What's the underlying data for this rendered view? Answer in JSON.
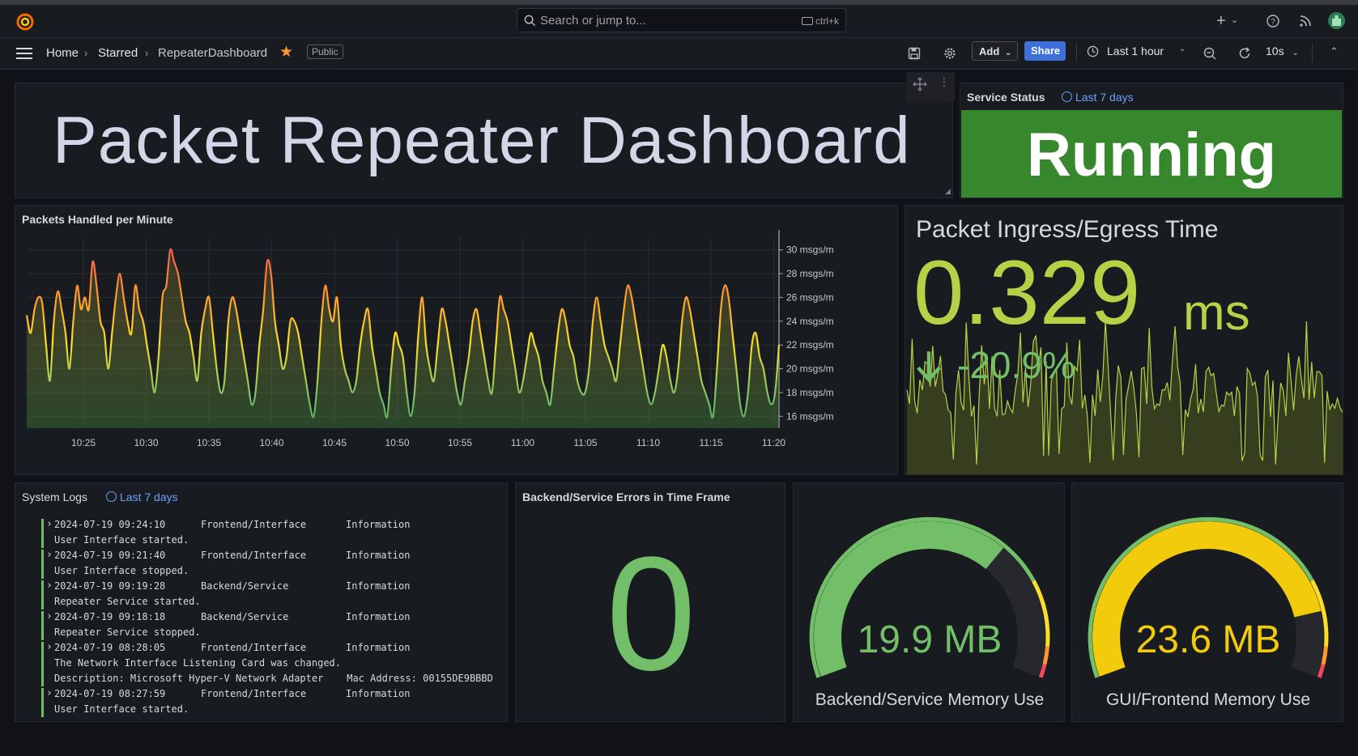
{
  "topbar": {
    "search_placeholder": "Search or jump to...",
    "search_shortcut": "ctrl+k"
  },
  "breadcrumb": {
    "home": "Home",
    "starred": "Starred",
    "dashboard": "RepeaterDashboard",
    "visibility": "Public"
  },
  "toolbar": {
    "add_label": "Add",
    "share_label": "Share",
    "time_range": "Last 1 hour",
    "refresh_interval": "10s"
  },
  "title_panel": {
    "text": "Packet Repeater Dashboard"
  },
  "service_status": {
    "title": "Service Status",
    "time_link": "Last 7 days",
    "value": "Running",
    "color": "#37872d"
  },
  "packets_chart": {
    "title": "Packets Handled per Minute"
  },
  "chart_data": {
    "type": "line",
    "x": [
      "10:25",
      "10:30",
      "10:35",
      "10:40",
      "10:45",
      "10:50",
      "10:55",
      "11:00",
      "11:05",
      "11:10",
      "11:15",
      "11:20"
    ],
    "ylim": [
      15,
      31
    ],
    "y_ticks": [
      "30 msgs/m",
      "28 msgs/m",
      "26 msgs/m",
      "24 msgs/m",
      "22 msgs/m",
      "20 msgs/m",
      "18 msgs/m",
      "16 msgs/m"
    ],
    "series": [
      {
        "values": [
          24.5,
          23,
          25,
          26,
          25.5,
          22,
          19,
          24,
          26.5,
          25,
          23,
          20,
          24,
          27,
          25,
          26,
          25,
          29,
          27,
          24,
          23,
          20,
          23,
          26,
          28,
          26,
          24,
          23,
          27,
          25,
          24,
          22,
          20,
          18,
          21,
          26,
          27,
          30,
          29,
          28,
          26,
          24,
          23,
          21,
          19,
          23,
          25,
          26,
          23,
          20,
          18,
          19,
          24,
          26,
          25,
          23,
          21,
          19,
          17,
          18,
          22,
          25,
          29,
          28,
          24,
          22,
          20,
          21,
          24,
          24,
          23,
          21,
          19,
          17,
          16,
          19,
          24,
          27,
          25,
          24,
          26,
          22,
          20,
          19,
          18,
          19,
          22,
          24,
          25,
          22,
          20,
          18,
          17,
          16,
          20,
          23,
          22,
          21,
          18,
          16,
          18,
          23,
          26,
          22,
          20,
          19,
          22,
          25,
          24,
          22,
          20,
          18,
          17,
          19,
          21,
          24,
          25,
          23,
          21,
          19,
          18,
          22,
          26,
          25,
          24,
          22,
          20,
          18,
          19,
          21,
          23,
          22,
          21,
          19,
          18,
          17,
          20,
          23,
          25,
          24,
          22,
          21,
          19,
          18,
          18,
          20,
          24,
          26,
          24,
          22,
          21,
          20,
          19,
          22,
          25,
          27,
          26,
          24,
          22,
          20,
          18,
          17,
          18,
          20,
          22,
          21,
          19,
          18,
          20,
          24,
          26,
          25,
          23,
          21,
          19,
          18,
          17,
          16,
          20,
          25,
          27,
          26,
          23,
          20,
          17,
          16,
          18,
          22,
          23,
          21,
          20,
          18,
          17,
          18,
          22
        ]
      }
    ]
  },
  "ingress_panel": {
    "title": "Packet Ingress/Egress Time",
    "value": "0.329",
    "unit": "ms",
    "change": "-20.9%",
    "color": "#b5d247"
  },
  "system_logs": {
    "title": "System Logs",
    "time_link": "Last 7 days",
    "entries": [
      {
        "timestamp": "2024-07-19 09:24:10",
        "source": "Frontend/Interface",
        "level": "Information",
        "lines": [
          "User Interface started."
        ]
      },
      {
        "timestamp": "2024-07-19 09:21:40",
        "source": "Frontend/Interface",
        "level": "Information",
        "lines": [
          "User Interface stopped."
        ]
      },
      {
        "timestamp": "2024-07-19 09:19:28",
        "source": "Backend/Service",
        "level": "Information",
        "lines": [
          "Repeater Service started."
        ]
      },
      {
        "timestamp": "2024-07-19 09:18:18",
        "source": "Backend/Service",
        "level": "Information",
        "lines": [
          "Repeater Service stopped."
        ]
      },
      {
        "timestamp": "2024-07-19 08:28:05",
        "source": "Frontend/Interface",
        "level": "Information",
        "lines": [
          "The Network Interface Listening Card was changed.",
          "Description: Microsoft Hyper-V Network Adapter    Mac Address: 00155DE9BBBD"
        ]
      },
      {
        "timestamp": "2024-07-19 08:27:59",
        "source": "Frontend/Interface",
        "level": "Information",
        "lines": [
          "User Interface started."
        ]
      }
    ]
  },
  "errors_panel": {
    "title": "Backend/Service Errors in Time Frame",
    "value": "0"
  },
  "gauge_backend": {
    "label": "Backend/Service Memory Use",
    "value": "19.9 MB",
    "fraction": 0.68,
    "color": "#73bf69"
  },
  "gauge_frontend": {
    "label": "GUI/Frontend Memory Use",
    "value": "23.6 MB",
    "fraction": 0.85,
    "color": "#f2cc0c"
  }
}
